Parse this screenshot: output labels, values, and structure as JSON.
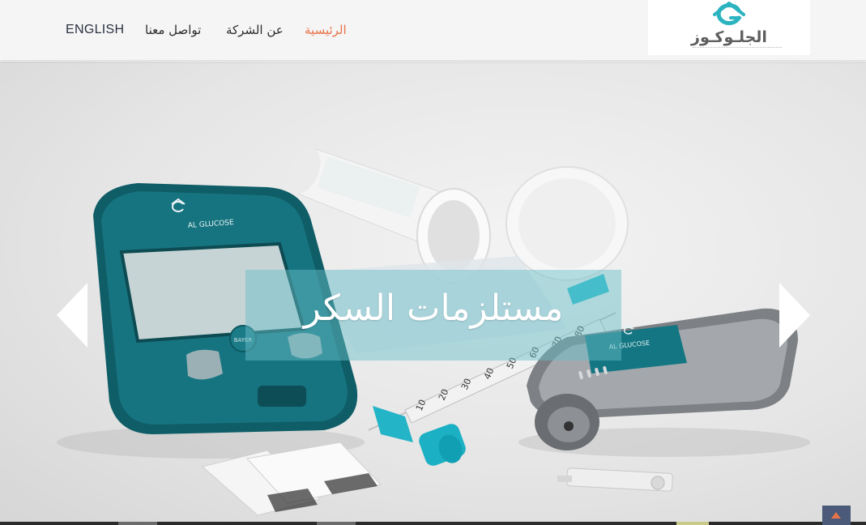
{
  "header": {
    "logo": {
      "icon_name": "glucose-g-icon",
      "text": "الجلـوكـوز"
    },
    "nav": [
      {
        "label": "الرئيسية",
        "active": true
      },
      {
        "label": "عن الشركة",
        "active": false
      },
      {
        "label": "تواصل معنا",
        "active": false
      },
      {
        "label": "ENGLISH",
        "active": false
      }
    ]
  },
  "hero": {
    "caption": "مستلزمات السكر",
    "prev_icon": "chevron-left-icon",
    "next_icon": "chevron-right-icon",
    "photo": {
      "meter_brand": "AL GLUCOSE",
      "lancer_brand": "AL GLUCOSE",
      "bayer_label": "BAYER",
      "syringe_scale": [
        "10",
        "20",
        "30",
        "40",
        "50",
        "60",
        "70",
        "80"
      ]
    }
  },
  "footer": {
    "scroll_top_icon": "arrow-up-icon"
  },
  "colors": {
    "accent": "#e8734a",
    "teal": "#1f7d85",
    "navbar_bg": "#f5f5f5",
    "scroll_button": "#4a5a78"
  }
}
